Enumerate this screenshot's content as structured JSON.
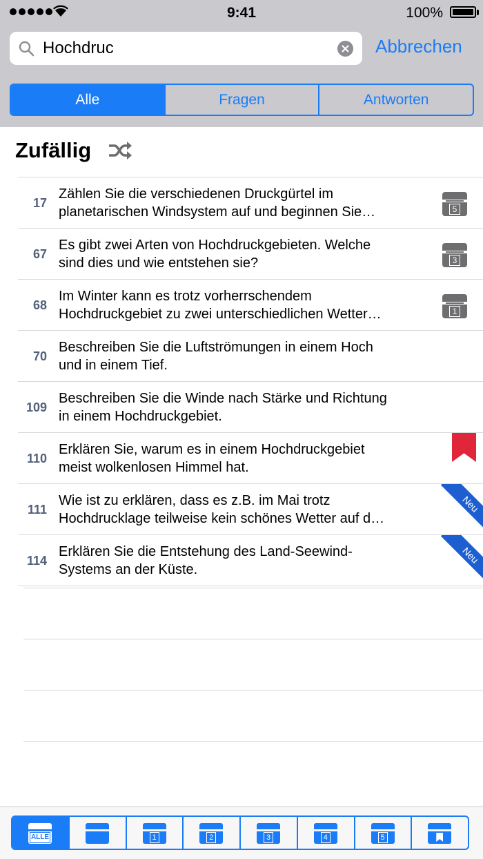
{
  "status_bar": {
    "time": "9:41",
    "battery": "100%"
  },
  "search": {
    "value": "Hochdruc",
    "cancel_label": "Abbrechen"
  },
  "segments": [
    "Alle",
    "Fragen",
    "Antworten"
  ],
  "section": {
    "title": "Zufällig"
  },
  "questions": [
    {
      "number": "17",
      "line1": "Zählen Sie die verschiedenen Druckgürtel im",
      "line2": "planetarischen Windsystem auf und beginnen Sie…",
      "box": "5"
    },
    {
      "number": "67",
      "line1": "Es gibt zwei Arten von Hochdruckgebieten. Welche",
      "line2": "sind dies und wie entstehen sie?",
      "box": "3"
    },
    {
      "number": "68",
      "line1": "Im Winter kann es trotz vorherrschendem",
      "line2": "Hochdruckgebiet zu zwei unterschiedlichen Wetter…",
      "box": "1"
    },
    {
      "number": "70",
      "line1": "Beschreiben Sie die Luftströmungen in einem Hoch",
      "line2": "und in einem Tief."
    },
    {
      "number": "109",
      "line1": "Beschreiben Sie die Winde nach Stärke und Richtung",
      "line2": "in einem Hochdruckgebiet."
    },
    {
      "number": "110",
      "line1": "Erklären Sie, warum es in einem Hochdruckgebiet",
      "line2": "meist wolkenlosen Himmel hat.",
      "bookmarked": true
    },
    {
      "number": "111",
      "line1": "Wie ist zu erklären, dass es z.B. im Mai trotz",
      "line2": "Hochdrucklage teilweise kein schönes Wetter auf d…",
      "new_label": "Neu"
    },
    {
      "number": "114",
      "line1": "Erklären Sie die Entstehung des Land-Seewind-",
      "line2": "Systems an der Küste.",
      "new_label": "Neu"
    }
  ],
  "tabs": [
    {
      "name": "tab-alle",
      "label": "ALLE",
      "selected": true
    },
    {
      "name": "tab-box-0",
      "label": ""
    },
    {
      "name": "tab-box-1",
      "label": "1"
    },
    {
      "name": "tab-box-2",
      "label": "2"
    },
    {
      "name": "tab-box-3",
      "label": "3"
    },
    {
      "name": "tab-box-4",
      "label": "4"
    },
    {
      "name": "tab-box-5",
      "label": "5"
    },
    {
      "name": "tab-bookmarks",
      "label": "",
      "bookmark": true
    }
  ],
  "colors": {
    "accent": "#1a7cf7",
    "bookmark": "#e0263a",
    "new_ribbon": "#1d5fd1",
    "badge": "#6e6e70"
  }
}
